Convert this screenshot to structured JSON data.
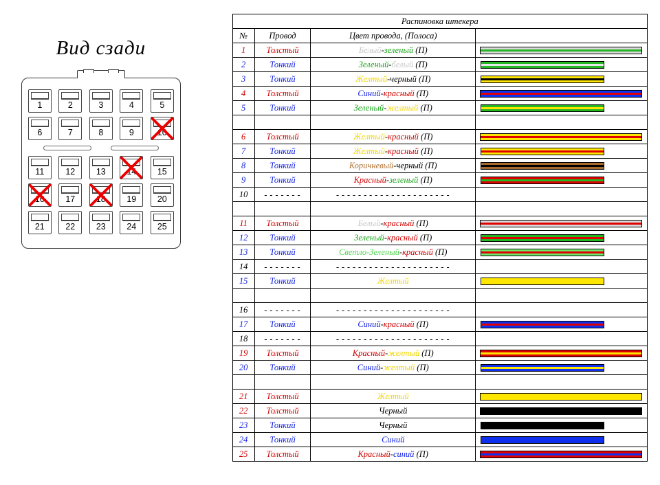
{
  "connector": {
    "title": "Вид сзади",
    "rows": [
      [
        {
          "n": 1
        },
        {
          "n": 2
        },
        {
          "n": 3
        },
        {
          "n": 4
        },
        {
          "n": 5
        }
      ],
      [
        {
          "n": 6
        },
        {
          "n": 7
        },
        {
          "n": 8
        },
        {
          "n": 9
        },
        {
          "n": 10,
          "x": true
        }
      ],
      [
        {
          "n": 11
        },
        {
          "n": 12
        },
        {
          "n": 13
        },
        {
          "n": 14,
          "x": true
        },
        {
          "n": 15
        }
      ],
      [
        {
          "n": 16,
          "x": true
        },
        {
          "n": 17
        },
        {
          "n": 18,
          "x": true
        },
        {
          "n": 19
        },
        {
          "n": 20
        }
      ],
      [
        {
          "n": 21
        },
        {
          "n": 22
        },
        {
          "n": 23
        },
        {
          "n": 24
        },
        {
          "n": 25
        }
      ]
    ]
  },
  "table": {
    "title": "Распиновка штекера",
    "headers": {
      "num": "№",
      "wire": "Провод",
      "color": "Цвет провода, (Полоса)"
    },
    "wire_labels": {
      "thick": "Толстый",
      "thin": "Тонкий",
      "none": "-------"
    },
    "color_none": "---------------------",
    "rows": [
      {
        "n": 1,
        "wire": "thick",
        "parts": [
          [
            "Белый",
            "#c8c8c8"
          ],
          [
            "-",
            "#000"
          ],
          [
            "зеленый",
            "#1aa51a"
          ],
          [
            " (П)",
            "#000"
          ]
        ],
        "sw": {
          "bg": "#d9d9d9",
          "stripe": "#23b723",
          "len": "long"
        }
      },
      {
        "n": 2,
        "wire": "thin",
        "parts": [
          [
            "Зеленый",
            "#1aa51a"
          ],
          [
            "-",
            "#000"
          ],
          [
            "белый",
            "#c8c8c8"
          ],
          [
            " (П)",
            "#000"
          ]
        ],
        "sw": {
          "bg": "#23b723",
          "stripe": "#e8e8e8",
          "len": "short"
        }
      },
      {
        "n": 3,
        "wire": "thin",
        "parts": [
          [
            "Желтый",
            "#f0d400"
          ],
          [
            "-черный (П)",
            "#000"
          ]
        ],
        "sw": {
          "bg": "#ffe600",
          "stripe": "#000",
          "len": "short"
        }
      },
      {
        "n": 4,
        "wire": "thick",
        "parts": [
          [
            "Синий",
            "#1020e0"
          ],
          [
            "-",
            "#000"
          ],
          [
            "красный",
            "#d00000"
          ],
          [
            " (П)",
            "#000"
          ]
        ],
        "sw": {
          "bg": "#1030f0",
          "stripe": "#e00000",
          "len": "long"
        }
      },
      {
        "n": 5,
        "wire": "thin",
        "parts": [
          [
            "Зеленый",
            "#1aa51a"
          ],
          [
            "-",
            "#000"
          ],
          [
            "желтый",
            "#f0d400"
          ],
          [
            " (П)",
            "#000"
          ]
        ],
        "sw": {
          "bg": "#23b723",
          "stripe": "#ffe600",
          "len": "short"
        }
      },
      {
        "gap": true
      },
      {
        "n": 6,
        "wire": "thick",
        "parts": [
          [
            "Желтый",
            "#f0d400"
          ],
          [
            "-",
            "#000"
          ],
          [
            "красный",
            "#d00000"
          ],
          [
            " (П)",
            "#000"
          ]
        ],
        "sw": {
          "bg": "#ffe600",
          "stripe": "#e00000",
          "len": "long"
        }
      },
      {
        "n": 7,
        "wire": "thin",
        "parts": [
          [
            "Желтый",
            "#f0d400"
          ],
          [
            "-",
            "#000"
          ],
          [
            "красный",
            "#d00000"
          ],
          [
            " (П)",
            "#000"
          ]
        ],
        "sw": {
          "bg": "#ffe600",
          "stripe": "#e00000",
          "len": "short"
        }
      },
      {
        "n": 8,
        "wire": "thin",
        "parts": [
          [
            "Коричневый",
            "#b07030"
          ],
          [
            "-черный (П)",
            "#000"
          ]
        ],
        "sw": {
          "bg": "#a86a2c",
          "stripe": "#000",
          "len": "short"
        }
      },
      {
        "n": 9,
        "wire": "thin",
        "parts": [
          [
            "Красный",
            "#d00000"
          ],
          [
            "-",
            "#000"
          ],
          [
            "зеленый",
            "#1aa51a"
          ],
          [
            " (П)",
            "#000"
          ]
        ],
        "sw": {
          "bg": "#e00000",
          "stripe": "#23b723",
          "len": "short"
        }
      },
      {
        "n": 10,
        "wire": "none",
        "parts": [],
        "sw": {
          "len": "none"
        }
      },
      {
        "gap": true
      },
      {
        "n": 11,
        "wire": "thick",
        "parts": [
          [
            "Белый",
            "#c8c8c8"
          ],
          [
            "-",
            "#000"
          ],
          [
            "красный",
            "#d00000"
          ],
          [
            " (П)",
            "#000"
          ]
        ],
        "sw": {
          "bg": "#d9d9d9",
          "stripe": "#e00000",
          "len": "long"
        }
      },
      {
        "n": 12,
        "wire": "thin",
        "parts": [
          [
            "Зеленый",
            "#1aa51a"
          ],
          [
            "-",
            "#000"
          ],
          [
            "красный",
            "#d00000"
          ],
          [
            " (П)",
            "#000"
          ]
        ],
        "sw": {
          "bg": "#23b723",
          "stripe": "#e00000",
          "len": "short"
        }
      },
      {
        "n": 13,
        "wire": "thin",
        "parts": [
          [
            "Светло-Зеленый",
            "#4fd64f"
          ],
          [
            "-",
            "#000"
          ],
          [
            "красный",
            "#d00000"
          ],
          [
            " (П)",
            "#000"
          ]
        ],
        "sw": {
          "bg": "#6de86d",
          "stripe": "#e00000",
          "len": "short"
        }
      },
      {
        "n": 14,
        "wire": "none",
        "parts": [],
        "sw": {
          "len": "none"
        }
      },
      {
        "n": 15,
        "wire": "thin",
        "parts": [
          [
            "Желтый",
            "#f0d400"
          ]
        ],
        "sw": {
          "bg": "#ffe600",
          "len": "short"
        }
      },
      {
        "gap": true
      },
      {
        "n": 16,
        "wire": "none",
        "parts": [],
        "sw": {
          "len": "none"
        }
      },
      {
        "n": 17,
        "wire": "thin",
        "parts": [
          [
            "Синий",
            "#1020e0"
          ],
          [
            "-",
            "#000"
          ],
          [
            "красный",
            "#d00000"
          ],
          [
            " (П)",
            "#000"
          ]
        ],
        "sw": {
          "bg": "#1030f0",
          "stripe": "#e00000",
          "len": "short"
        }
      },
      {
        "n": 18,
        "wire": "none",
        "parts": [],
        "sw": {
          "len": "none"
        }
      },
      {
        "n": 19,
        "wire": "thick",
        "parts": [
          [
            "Красный",
            "#d00000"
          ],
          [
            "-",
            "#000"
          ],
          [
            "желтый",
            "#f0d400"
          ],
          [
            " (П)",
            "#000"
          ]
        ],
        "sw": {
          "bg": "#e00000",
          "stripe": "#ffe600",
          "len": "long"
        }
      },
      {
        "n": 20,
        "wire": "thin",
        "parts": [
          [
            "Синий",
            "#1020e0"
          ],
          [
            "-",
            "#000"
          ],
          [
            "желтый",
            "#f0d400"
          ],
          [
            " (П)",
            "#000"
          ]
        ],
        "sw": {
          "bg": "#1030f0",
          "stripe": "#ffe600",
          "len": "short"
        }
      },
      {
        "gap": true
      },
      {
        "n": 21,
        "wire": "thick",
        "parts": [
          [
            "Желтый",
            "#f0d400"
          ]
        ],
        "sw": {
          "bg": "#ffe600",
          "len": "long"
        }
      },
      {
        "n": 22,
        "wire": "thick",
        "parts": [
          [
            "Черный",
            "#000"
          ]
        ],
        "sw": {
          "bg": "#000",
          "len": "long"
        }
      },
      {
        "n": 23,
        "wire": "thin",
        "parts": [
          [
            "Черный",
            "#000"
          ]
        ],
        "sw": {
          "bg": "#000",
          "len": "short"
        }
      },
      {
        "n": 24,
        "wire": "thin",
        "parts": [
          [
            "Синий",
            "#1020e0"
          ]
        ],
        "sw": {
          "bg": "#1030f0",
          "len": "short"
        }
      },
      {
        "n": 25,
        "wire": "thick",
        "parts": [
          [
            "Красный",
            "#d00000"
          ],
          [
            "-",
            "#000"
          ],
          [
            "синий",
            "#1020e0"
          ],
          [
            " (П)",
            "#000"
          ]
        ],
        "sw": {
          "bg": "#e00000",
          "stripe": "#1030f0",
          "len": "long"
        }
      }
    ]
  }
}
